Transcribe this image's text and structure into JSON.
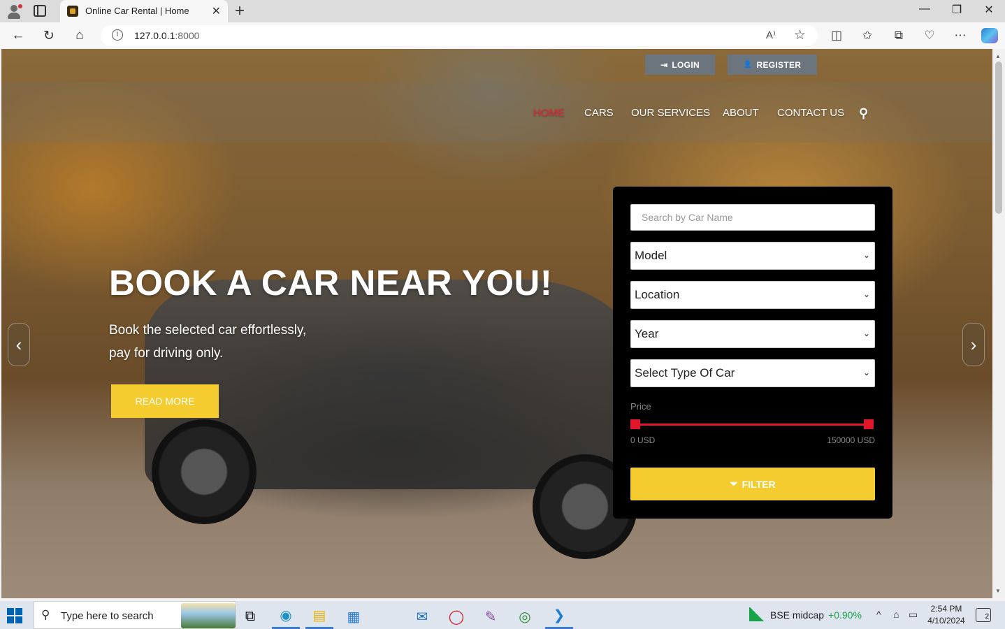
{
  "browser": {
    "tab_title": "Online Car Rental | Home",
    "tab_close": "✕",
    "new_tab": "+",
    "url_host": "127.0.0.1",
    "url_port": ":8000",
    "window_controls": {
      "minimize": "—",
      "restore": "❐",
      "close": "✕"
    },
    "nav": {
      "back": "←",
      "reload": "↻",
      "home": "⌂"
    },
    "read_aloud": "A⁾",
    "favorite": "☆",
    "toolbar_icons": {
      "split": "◫",
      "favorites": "✩",
      "collections": "⧉",
      "extensions": "♡",
      "more": "⋯"
    }
  },
  "page": {
    "auth": {
      "login": "LOGIN",
      "register": "REGISTER",
      "login_icon": "⇥",
      "register_icon": "👤"
    },
    "menu": [
      {
        "label": "HOME",
        "active": true
      },
      {
        "label": "CARS",
        "active": false
      },
      {
        "label": "OUR SERVICES",
        "active": false
      },
      {
        "label": "ABOUT",
        "active": false
      },
      {
        "label": "CONTACT US",
        "active": false
      }
    ],
    "search_icon": "⚲",
    "hero": {
      "title": "BOOK A CAR NEAR YOU!",
      "line1": "Book the selected car effortlessly,",
      "line2": "pay for driving only.",
      "read_more": "READ MORE"
    },
    "carousel": {
      "prev": "‹",
      "next": "›"
    },
    "filter": {
      "search_placeholder": "Search by Car Name",
      "selects": [
        "Model",
        "Location",
        "Year",
        "Select Type Of Car"
      ],
      "select_chevron": "⌄",
      "price_label": "Price",
      "price_min": "0 USD",
      "price_max": "150000 USD",
      "filter_button": "FILTER",
      "filter_icon": "⏷"
    }
  },
  "taskbar": {
    "search_placeholder": "Type here to search",
    "search_icon": "⚲",
    "apps": [
      {
        "name": "task-view",
        "glyph": "⧉",
        "active": false
      },
      {
        "name": "edge",
        "glyph": "◉",
        "active": true
      },
      {
        "name": "file-explorer",
        "glyph": "▤",
        "active": true
      },
      {
        "name": "store",
        "glyph": "▦",
        "active": false
      },
      {
        "name": "mail",
        "glyph": "✉",
        "active": false
      },
      {
        "name": "opera",
        "glyph": "◯",
        "active": false
      },
      {
        "name": "paint",
        "glyph": "✎",
        "active": false
      },
      {
        "name": "chrome",
        "glyph": "◎",
        "active": false
      },
      {
        "name": "vscode",
        "glyph": "❯",
        "active": true
      }
    ],
    "stock_name": "BSE midcap",
    "stock_change": "+0.90%",
    "tray": {
      "chevron": "^",
      "network": "⌂",
      "wifi": "▭"
    },
    "time": "2:54 PM",
    "date": "4/10/2024",
    "notifications": "2"
  },
  "colors": {
    "accent_red": "#e32636",
    "button_yellow": "#f4cc2f",
    "panel_black": "#000000",
    "auth_gray": "#6c757d"
  }
}
